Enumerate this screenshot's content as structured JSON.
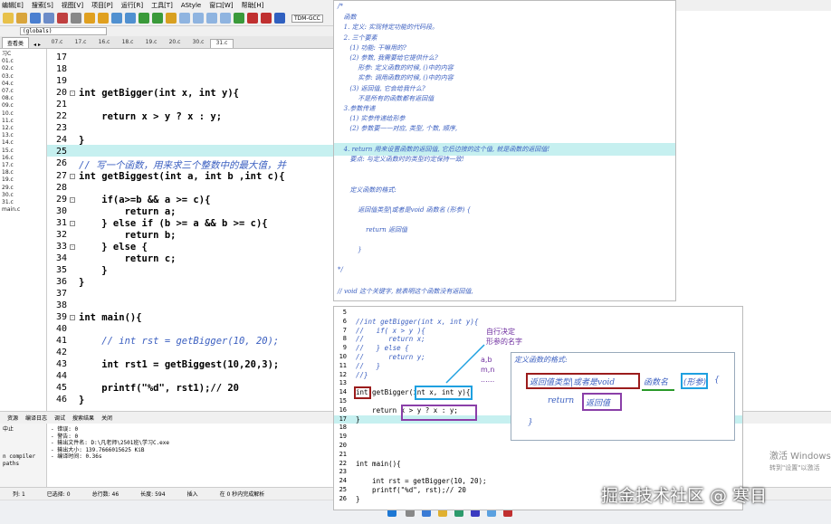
{
  "menu": [
    "编辑[E]",
    "搜索[S]",
    "视图[V]",
    "项目[P]",
    "运行[R]",
    "工具[T]",
    "AStyle",
    "窗口[W]",
    "帮助[H]"
  ],
  "toolbar": {
    "compiler": "TDM-GCC"
  },
  "globals": "(globals)",
  "project_tab": "查看类",
  "file_tabs": [
    "07.c",
    "17.c",
    "16.c",
    "18.c",
    "19.c",
    "20.c",
    "30.c",
    "31.c"
  ],
  "active_tab": "31.c",
  "tree_items": [
    "习C",
    "01.c",
    "02.c",
    "03.c",
    "04.c",
    "07.c",
    "08.c",
    "09.c",
    "10.c",
    "11.c",
    "12.c",
    "13.c",
    "14.c",
    "15.c",
    "16.c",
    "17.c",
    "18.c",
    "19.c",
    "29.c",
    "30.c",
    "31.c",
    "main.c"
  ],
  "editor_lines": [
    {
      "n": "17",
      "t": ""
    },
    {
      "n": "18",
      "t": ""
    },
    {
      "n": "19",
      "t": ""
    },
    {
      "n": "20",
      "t": "int getBigger(int x, int y){"
    },
    {
      "n": "21",
      "t": ""
    },
    {
      "n": "22",
      "t": "    return x > y ? x : y;"
    },
    {
      "n": "23",
      "t": ""
    },
    {
      "n": "24",
      "t": "}"
    },
    {
      "n": "25",
      "t": ""
    },
    {
      "n": "26",
      "t": "// 写一个函数，用来求三个整数中的最大值，并"
    },
    {
      "n": "27",
      "t": "int getBiggest(int a, int b ,int c){"
    },
    {
      "n": "28",
      "t": ""
    },
    {
      "n": "29",
      "t": "    if(a>=b && a >= c){"
    },
    {
      "n": "30",
      "t": "        return a;"
    },
    {
      "n": "31",
      "t": "    } else if (b >= a && b >= c){"
    },
    {
      "n": "32",
      "t": "        return b;"
    },
    {
      "n": "33",
      "t": "    } else {"
    },
    {
      "n": "34",
      "t": "        return c;"
    },
    {
      "n": "35",
      "t": "    }"
    },
    {
      "n": "36",
      "t": "}"
    },
    {
      "n": "37",
      "t": ""
    },
    {
      "n": "38",
      "t": ""
    },
    {
      "n": "39",
      "t": "int main(){"
    },
    {
      "n": "40",
      "t": ""
    },
    {
      "n": "41",
      "t": "    // int rst = getBigger(10, 20);"
    },
    {
      "n": "42",
      "t": ""
    },
    {
      "n": "43",
      "t": "    int rst1 = getBiggest(10,20,3);"
    },
    {
      "n": "44",
      "t": ""
    },
    {
      "n": "45",
      "t": "    printf(\"%d\", rst1);// 20"
    },
    {
      "n": "46",
      "t": "}"
    }
  ],
  "bottom_tabs": [
    "资源",
    "编译日志",
    "调试",
    "搜索结果",
    "关闭"
  ],
  "output": {
    "left": [
      "中止",
      "",
      "",
      "",
      "n compiler paths"
    ],
    "lines": [
      "- 错误: 0",
      "- 警告: 0",
      "- 输出文件名: D:\\凡老师\\2501班\\学习C.exe",
      "- 输出大小: 139.7666015625 KiB",
      "- 编译时间: 0.36s"
    ]
  },
  "status": {
    "col_label": "列:",
    "col": "1",
    "sel_label": "已选择:",
    "sel": "0",
    "total_label": "总行数:",
    "total": "46",
    "len_label": "长度:",
    "len": "594",
    "mode": "插入",
    "parse": "在 0 秒内完成解析"
  },
  "notes_lines": [
    "/*",
    "   函数",
    "   1. 定义: 实现特定功能的代码段。",
    "   2. 三个要素",
    "      (1) 功能: 干嘛用的?",
    "      (2) 参数, 我需要给它提供什么?",
    "          形参: 定义函数的时候, ()中的内容",
    "          实参: 调用函数的时候, ()中的内容",
    "      (3) 返回值, 它会给我什么?",
    "          不是所有的函数都有返回值",
    "   3.参数传递",
    "      (1) 实参传递给形参",
    "      (2) 参数要一一对应, 类型, 个数, 顺序,",
    "",
    "   4. return 用来设置函数的返回值, 它后边接的这个值, 就是函数的返回值!",
    "      要点: 与定义函数时的类型约定保持一致!",
    "",
    "",
    "      定义函数的格式:",
    "",
    "          返回值类型|或者是void 函数名 (形参) {",
    "",
    "              return 返回值",
    "",
    "          }",
    "",
    "*/",
    "",
    "// void 这个关键字, 就表明这个函数没有返回值,"
  ],
  "right_lines": [
    {
      "n": "5",
      "t": ""
    },
    {
      "n": "6",
      "t": "//int getBigger(int x, int y){"
    },
    {
      "n": "7",
      "t": "//   if( x > y ){"
    },
    {
      "n": "8",
      "t": "//      return x;"
    },
    {
      "n": "9",
      "t": "//   } else {"
    },
    {
      "n": "10",
      "t": "//      return y;"
    },
    {
      "n": "11",
      "t": "//   }"
    },
    {
      "n": "12",
      "t": "//}"
    },
    {
      "n": "13",
      "t": ""
    },
    {
      "n": "14",
      "t": "int getBigger(int x, int y){"
    },
    {
      "n": "15",
      "t": ""
    },
    {
      "n": "16",
      "t": "    return x > y ? x : y;"
    },
    {
      "n": "17",
      "t": "}"
    },
    {
      "n": "18",
      "t": ""
    },
    {
      "n": "19",
      "t": ""
    },
    {
      "n": "20",
      "t": ""
    },
    {
      "n": "21",
      "t": ""
    },
    {
      "n": "22",
      "t": "int main(){"
    },
    {
      "n": "23",
      "t": ""
    },
    {
      "n": "24",
      "t": "    int rst = getBigger(10, 20);"
    },
    {
      "n": "25",
      "t": "    printf(\"%d\", rst);// 20"
    },
    {
      "n": "26",
      "t": "}"
    }
  ],
  "annotations": {
    "self_decide": "自行决定",
    "param_name": "形参的名字",
    "ab": "a,b",
    "mn": "m,n",
    "dots": "......"
  },
  "inner_box": {
    "title": "定义函数的格式:",
    "l1a": "返回值类型|或者是void",
    "l1b": "函数名",
    "l1c": "(形参)",
    "l1d": "{",
    "l2a": "return",
    "l2b": "返回值",
    "l3": "}"
  },
  "watermark": "掘金技术社区 @ 寒日",
  "windows_activate": {
    "l1": "激活 Windows",
    "l2": "转到\"设置\"以激活"
  }
}
